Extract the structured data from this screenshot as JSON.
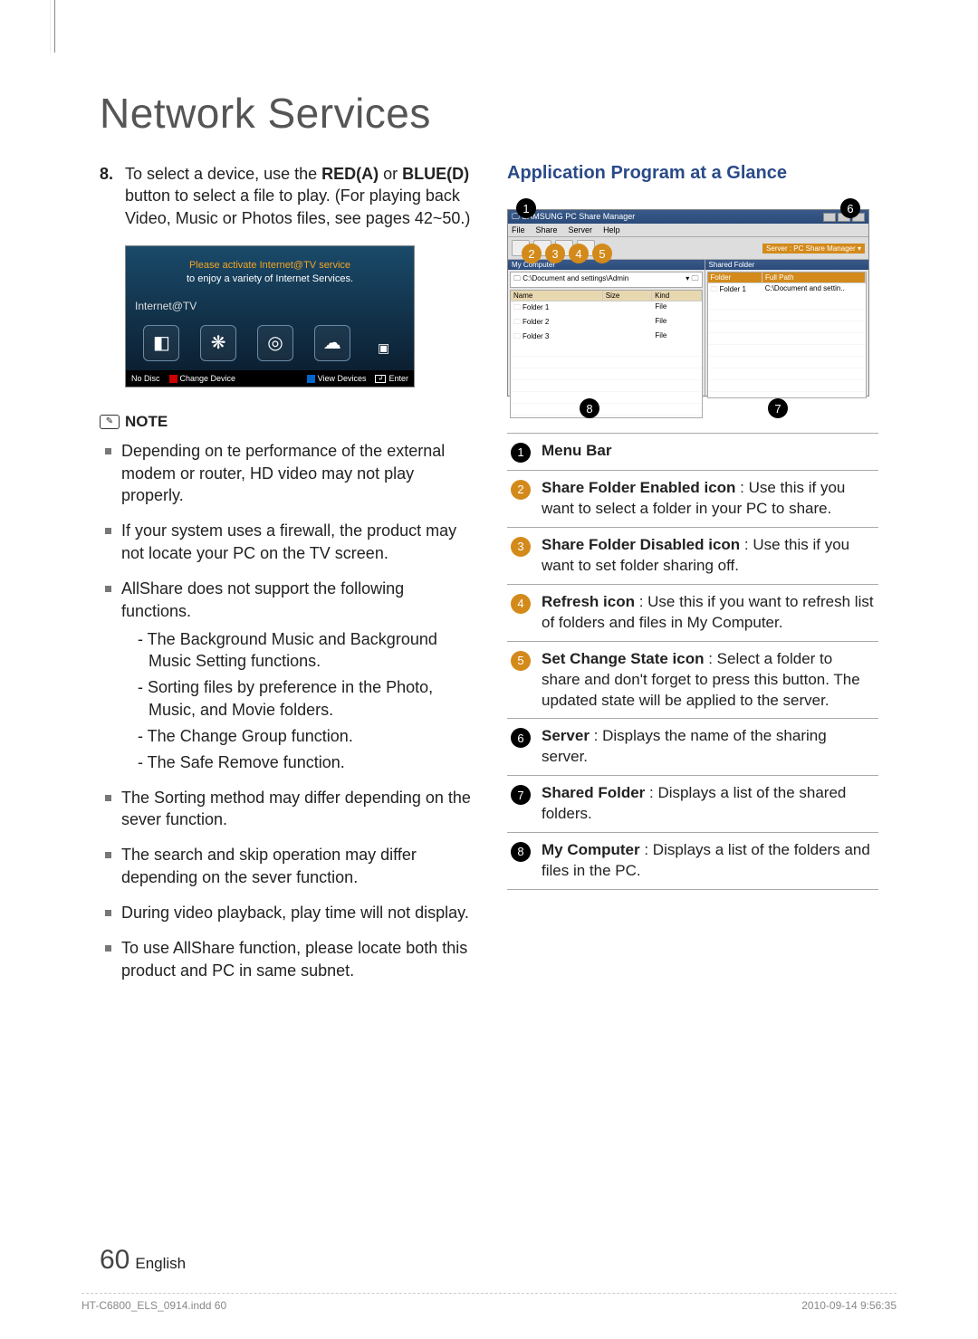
{
  "header": {
    "title": "Network Services"
  },
  "left": {
    "step8_num": "8.",
    "step8_pre": "To select a device, use the ",
    "step8_red": "RED(A)",
    "step8_mid": " or ",
    "step8_blue": "BLUE(D)",
    "step8_post": " button to select a file to play. (For playing back Video, Music or Photos files, see pages 42~50.)",
    "itv": {
      "line1": "Please activate Internet@TV service",
      "line2": "to enjoy a variety of Internet Services.",
      "label": "Internet@TV",
      "bar_nodisc": "No Disc",
      "bar_change": "Change Device",
      "bar_view": "View Devices",
      "bar_enter": "Enter"
    },
    "note_label": "NOTE",
    "notes": [
      "Depending on te performance of the external modem or router, HD video may not play properly.",
      "If your system uses a firewall, the product may not locate your PC on the TV screen.",
      "AllShare does not support the following functions.",
      "The Sorting method may differ depending on the sever function.",
      "The search and skip operation may differ depending on the sever function.",
      "During video playback, play time will not display.",
      "To use AllShare function, please locate both this product and PC in same subnet."
    ],
    "sub_notes": [
      "- The Background Music and Background Music Setting functions.",
      "- Sorting files by preference in the Photo, Music, and Movie folders.",
      "- The Change Group function.",
      "- The Safe Remove function."
    ]
  },
  "right": {
    "app_title": "Application Program at a Glance",
    "shot": {
      "win_title": "SAMSUNG PC Share Manager",
      "menus": [
        "File",
        "Share",
        "Server",
        "Help"
      ],
      "server_label": "Server : PC Share Manager ▾",
      "left_head": "My Computer",
      "path": "C:\\Document and settings\\Admin",
      "left_cols": [
        "Name",
        "Size",
        "Kind"
      ],
      "left_rows": [
        {
          "name": "Folder 1",
          "size": "",
          "kind": "File"
        },
        {
          "name": "Folder 2",
          "size": "",
          "kind": "File"
        },
        {
          "name": "Folder 3",
          "size": "",
          "kind": "File"
        }
      ],
      "right_head": "Shared Folder",
      "right_cols": [
        "Folder",
        "Full Path"
      ],
      "right_rows": [
        {
          "folder": "Folder 1",
          "path": "C:\\Document and settin.."
        }
      ]
    },
    "legend": [
      {
        "n": "1",
        "bold": "Menu Bar",
        "rest": ""
      },
      {
        "n": "2",
        "bold": "Share Folder Enabled icon",
        "rest": " : Use this if you want to select a folder in your PC to share."
      },
      {
        "n": "3",
        "bold": "Share Folder Disabled icon",
        "rest": " : Use this if you want to set folder sharing off."
      },
      {
        "n": "4",
        "bold": "Refresh icon",
        "rest": " : Use this if you want to refresh list of folders and files in My Computer."
      },
      {
        "n": "5",
        "bold": "Set Change State icon",
        "rest": " : Select a folder to share and don't forget to press this button. The updated state will be applied to the server."
      },
      {
        "n": "6",
        "bold": "Server",
        "rest": " : Displays the name of the sharing server."
      },
      {
        "n": "7",
        "bold": "Shared Folder",
        "rest": " : Displays a list of the shared folders."
      },
      {
        "n": "8",
        "bold": "My Computer",
        "rest": " : Displays a list of the folders and files in the PC."
      }
    ]
  },
  "pagenum": {
    "big": "60",
    "lang": "English"
  },
  "footer": {
    "left": "HT-C6800_ELS_0914.indd   60",
    "right": "2010-09-14     9:56:35"
  }
}
